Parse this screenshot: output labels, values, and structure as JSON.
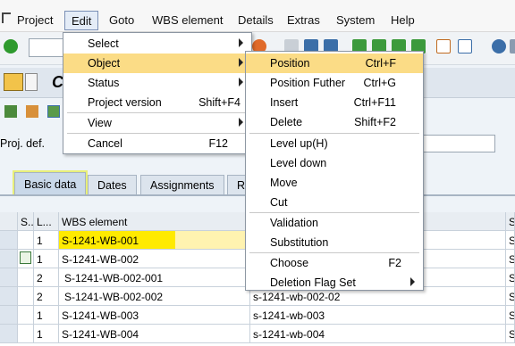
{
  "menubar": {
    "items": [
      "Project",
      "Edit",
      "Goto",
      "WBS element",
      "Details",
      "Extras",
      "System",
      "Help"
    ],
    "active_index": 1
  },
  "colors": {
    "menu_highlight": "#fbdc86",
    "selected_cell": "#ffea00",
    "tab_highlight": "#e6ee50"
  },
  "edit_menu": {
    "items": [
      {
        "label": "Select",
        "shortcut": "",
        "submenu": true
      },
      {
        "label": "Object",
        "shortcut": "",
        "submenu": true,
        "highlighted": true
      },
      {
        "label": "Status",
        "shortcut": "",
        "submenu": true
      },
      {
        "label": "Project version",
        "shortcut": "Shift+F4",
        "submenu": false
      },
      {
        "label": "View",
        "shortcut": "",
        "submenu": true
      },
      {
        "label": "Cancel",
        "shortcut": "F12",
        "submenu": false
      }
    ]
  },
  "object_menu": {
    "items": [
      {
        "label": "Position",
        "shortcut": "Ctrl+F",
        "highlighted": true
      },
      {
        "label": "Position Futher",
        "shortcut": "Ctrl+G"
      },
      {
        "label": "Insert",
        "shortcut": "Ctrl+F11"
      },
      {
        "label": "Delete",
        "shortcut": "Shift+F2"
      },
      {
        "label": "Level up(H)",
        "shortcut": ""
      },
      {
        "label": "Level down",
        "shortcut": ""
      },
      {
        "label": "Move",
        "shortcut": ""
      },
      {
        "label": "Cut",
        "shortcut": ""
      },
      {
        "label": "Validation",
        "shortcut": ""
      },
      {
        "label": "Substitution",
        "shortcut": ""
      },
      {
        "label": "Choose",
        "shortcut": "F2"
      },
      {
        "label": "Deletion Flag Set",
        "shortcut": "",
        "submenu": true
      }
    ]
  },
  "header": {
    "title_letter": "C"
  },
  "proj_label": "Proj. def.",
  "tabs": [
    "Basic data",
    "Dates",
    "Assignments",
    "Re"
  ],
  "table": {
    "headers": [
      "S..",
      "L...",
      "WBS element",
      "",
      "S"
    ],
    "rows": [
      {
        "level": "1",
        "wbs": "S-1241-WB-001",
        "desc": "",
        "s": "S-"
      },
      {
        "level": "1",
        "wbs": "S-1241-WB-002",
        "desc": "",
        "s": "S-"
      },
      {
        "level": "2",
        "wbs": "S-1241-WB-002-001",
        "desc": "",
        "s": "S-"
      },
      {
        "level": "2",
        "wbs": "S-1241-WB-002-002",
        "desc": "s-1241-wb-002-02",
        "s": "S-"
      },
      {
        "level": "1",
        "wbs": "S-1241-WB-003",
        "desc": "s-1241-wb-003",
        "s": "S-"
      },
      {
        "level": "1",
        "wbs": "S-1241-WB-004",
        "desc": "s-1241-wb-004",
        "s": "S-"
      }
    ]
  }
}
